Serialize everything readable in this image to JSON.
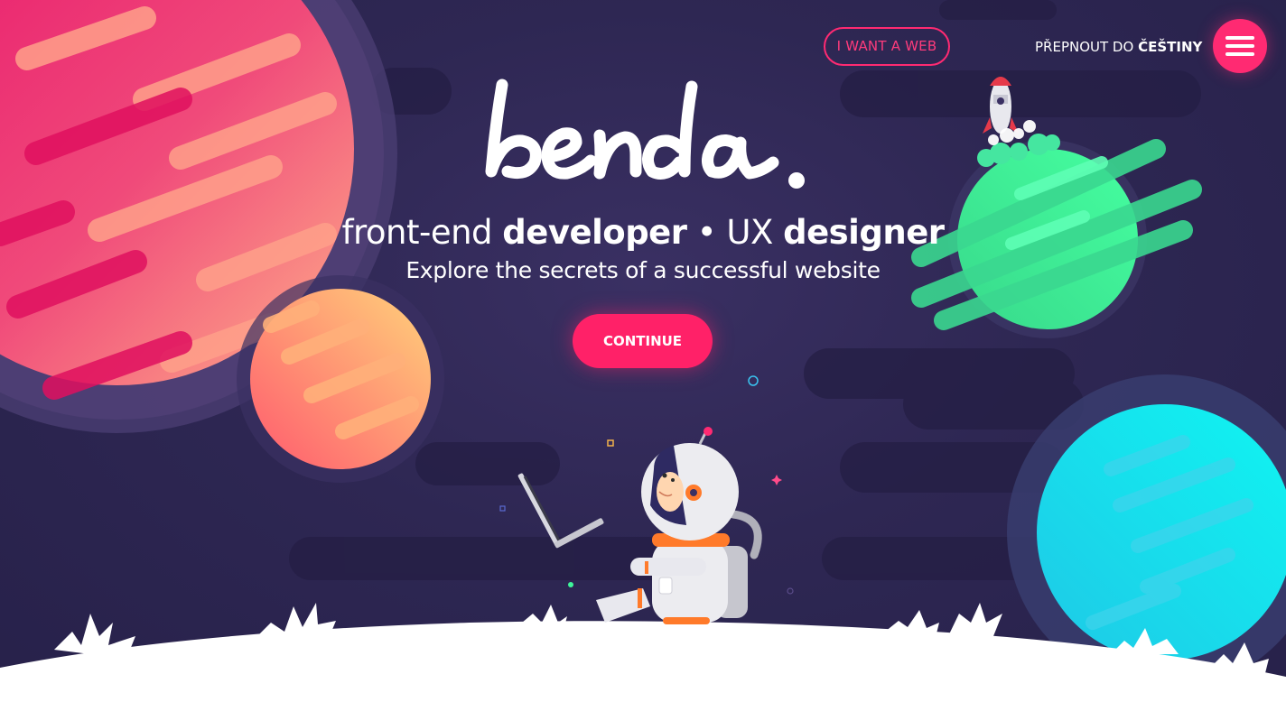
{
  "nav": {
    "want_web_label": "I WANT A WEB",
    "lang_prefix": "PŘEPNOUT DO",
    "lang_target": "ČEŠTINY",
    "menu_icon": "hamburger-menu-icon"
  },
  "hero": {
    "logo_text": "benda.",
    "tagline": {
      "part1": "front-end ",
      "part2": "developer",
      "part3": " • UX ",
      "part4": "designer"
    },
    "subtitle": "Explore the secrets of a successful website",
    "continue_label": "CONTINUE"
  },
  "colors": {
    "background": "#2d2550",
    "accent": "#ff2168",
    "planet_pink": "#f0246a",
    "planet_orange": "#ff7a5c",
    "planet_green": "#3ef79a",
    "planet_cyan": "#14eef0",
    "ground": "#ffffff"
  },
  "decor": {
    "astronaut": "astronaut-with-laptop-illustration",
    "rocket": "rocket-icon"
  }
}
